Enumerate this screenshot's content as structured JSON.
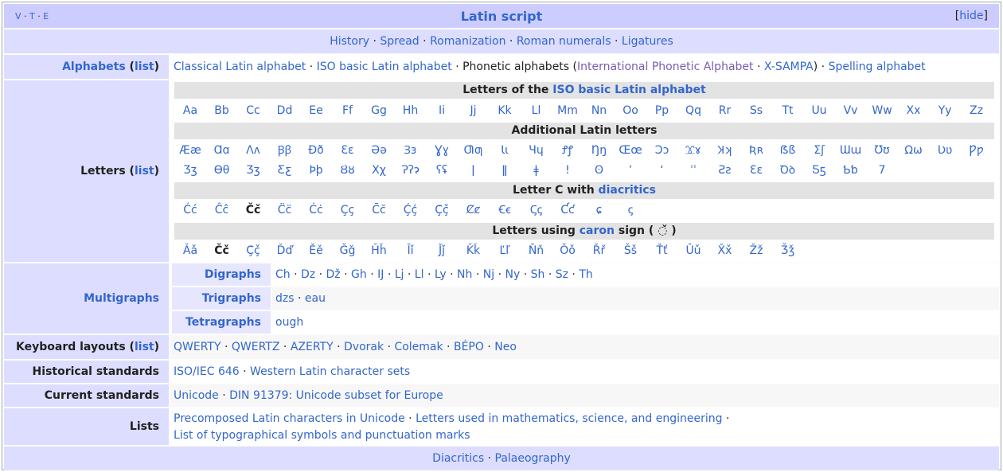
{
  "header": {
    "v": "V",
    "t": "T",
    "e": "E",
    "title": "Latin script",
    "hide_open": "[",
    "hide_label": "hide",
    "hide_close": "]"
  },
  "topics": [
    "History",
    "Spread",
    "Romanization",
    "Roman numerals",
    "Ligatures"
  ],
  "alphabets": {
    "label": "Alphabets",
    "list": "list",
    "items": [
      "Classical Latin alphabet",
      "ISO basic Latin alphabet"
    ],
    "phonetic": "Phonetic alphabets",
    "ipa": "International Phonetic Alphabet",
    "xsampa": "X-SAMPA",
    "spelling": "Spelling alphabet"
  },
  "letters": {
    "label": "Letters",
    "list": "list",
    "iso_head_pre": "Letters of the ",
    "iso_head_link": "ISO basic Latin alphabet",
    "iso": [
      "Aa",
      "Bb",
      "Cc",
      "Dd",
      "Ee",
      "Ff",
      "Gg",
      "Hh",
      "Ii",
      "Jj",
      "Kk",
      "Ll",
      "Mm",
      "Nn",
      "Oo",
      "Pp",
      "Qq",
      "Rr",
      "Ss",
      "Tt",
      "Uu",
      "Vv",
      "Ww",
      "Xx",
      "Yy",
      "Zz"
    ],
    "additional_head": "Additional Latin letters",
    "additional1": [
      "Ææ",
      "Ɑɑ",
      "Ʌʌ",
      "Ꞵꞵ",
      "Ðð",
      "Ɛɛ",
      "Əə",
      "Ɜɜ",
      "Ɣɣ",
      "Ƣƣ",
      "Ɩɩ",
      "Ɥɥ",
      "Ꝭꝭ",
      "Ŋŋ",
      "Œœ",
      "Ɔɔ",
      "Ɤɤ",
      "Ʞʞ",
      "Ʀʀ",
      "ẞß",
      "Ʃʃ",
      "Ɯɯ",
      "Ʊʊ",
      "Ωω",
      "Ʋʋ",
      "Ƿƿ"
    ],
    "additional2": [
      "Ʒʒ",
      "Ɵθ",
      "Ʒʒ",
      "Ƹƹ",
      "Þþ",
      "Ȣȣ",
      "Χχ",
      "Ɂʔɂ",
      "ʕʢ",
      "ǀ",
      "ǁ",
      "ǂ",
      "ǃ",
      "ʘ",
      "ʼ",
      "ʻ",
      "ˈˈ",
      "Ƨƨ",
      "Ɛɛ",
      "Ꝺꝺ",
      "Ƽƽ",
      "Ƅƅ",
      "7"
    ],
    "c_head_pre": "Letter C with ",
    "c_head_link": "diacritics",
    "c_letters": [
      "Ćć",
      "Ĉĉ",
      "Čč",
      "C̈c̈",
      "Ċċ",
      "Çç",
      "C̄c̄",
      "Ḉḉ",
      "Ç̌ç̌",
      "Ȼȼ",
      "Ꞓꞓ",
      "Ꞔꞔ",
      "Ƈƈ",
      "ɕ",
      "ꞔ"
    ],
    "caron_head_pre": "Letters using ",
    "caron_head_link": "caron",
    "caron_head_post": " sign ( ◌̌ )",
    "caron_letters": [
      "Ǎǎ",
      "Čč",
      "Ç̌ç̌",
      "Ďď",
      "Ěě",
      "Ǧǧ",
      "Ȟȟ",
      "Ǐǐ",
      "J̌ǰ",
      "Ǩǩ",
      "Ľľ",
      "Ňň",
      "Ǒǒ",
      "Řř",
      "Šš",
      "Ťť",
      "Ǔǔ",
      "X̌x̌",
      "Žž",
      "Ǯǯ"
    ]
  },
  "multigraphs": {
    "label": "Multigraphs",
    "digraphs_label": "Digraphs",
    "digraphs": [
      "Ch",
      "Dz",
      "Dž",
      "Gh",
      "IJ",
      "Lj",
      "Ll",
      "Ly",
      "Nh",
      "Nj",
      "Ny",
      "Sh",
      "Sz",
      "Th"
    ],
    "trigraphs_label": "Trigraphs",
    "trigraphs": [
      "dzs",
      "eau"
    ],
    "tetragraphs_label": "Tetragraphs",
    "tetragraphs": [
      "ough"
    ]
  },
  "keyboard": {
    "label": "Keyboard layouts",
    "list": "list",
    "items": [
      "QWERTY",
      "QWERTZ",
      "AZERTY",
      "Dvorak",
      "Colemak",
      "BÉPO",
      "Neo"
    ]
  },
  "historical": {
    "label": "Historical standards",
    "items": [
      "ISO/IEC 646",
      "Western Latin character sets"
    ]
  },
  "current": {
    "label": "Current standards",
    "items": [
      "Unicode",
      "DIN 91379: Unicode subset for Europe"
    ]
  },
  "lists": {
    "label": "Lists",
    "line1": [
      "Precomposed Latin characters in Unicode",
      "Letters used in mathematics, science, and engineering"
    ],
    "line2": "List of typographical symbols and punctuation marks"
  },
  "footer": [
    "Diacritics",
    "Palaeography"
  ],
  "colors": {
    "title_bar": "#ccccff",
    "group_bg": "#ddddff",
    "link": "#3366cc",
    "visited": "#795cb2"
  }
}
